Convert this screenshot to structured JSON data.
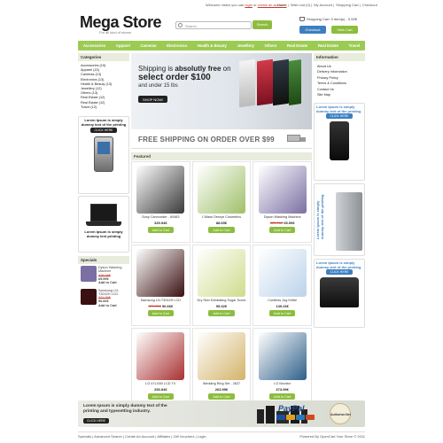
{
  "topbar": {
    "welcome": "Welcome visitor you can",
    "login": "login",
    "or": "or",
    "create": "create an account.",
    "links": [
      "Home",
      "Wish List (0)",
      "My Account",
      "Shopping Cart",
      "Checkout"
    ]
  },
  "header": {
    "logo": "Mega Store",
    "tagline": "For all kind of stores",
    "search_placeholder": "Search",
    "search_button": "Search",
    "cart_text": "Shopping Cart: 0 item(s) - 0.00€",
    "checkout_button": "Checkout",
    "viewcart_button": "View Cart"
  },
  "nav": [
    "Accessories",
    "Apparel",
    "Cameras",
    "Electronics",
    "Health & Beauty",
    "Jewellery",
    "Others",
    "Real Estate",
    "Real Estate",
    "Travel"
  ],
  "categories": {
    "title": "Categories",
    "items": [
      "Accessories (15)",
      "Apparel (15)",
      "Cameras (13)",
      "Electronics (13)",
      "Health & Beauty (13)",
      "Jewellery (12)",
      "Others (13)",
      "Real Estate (12)",
      "Real Estate (12)",
      "Travel (12)"
    ]
  },
  "promo_left_1": {
    "title": "Lorem Ipsum is simply dummy text of the printing",
    "button": "CLICK HERE"
  },
  "promo_left_2": {
    "title": "Lorem Ipsum is simply dummy text printing"
  },
  "specials": {
    "title": "Specials",
    "items": [
      {
        "name": "Dyson Washing Machine",
        "old": "425.26€",
        "price": "65.99€",
        "button": "Add to Cart"
      },
      {
        "name": "Samsung LN-T3242H LCD",
        "old": "371.25€",
        "price": "56.66€",
        "button": "Add to Cart"
      }
    ]
  },
  "banner": {
    "line1_a": "Shipping is",
    "line1_b": "absolutly free",
    "line1_c": "on",
    "line2": "select order $100",
    "line3": "and under 15 lbs",
    "button": "SHOP NOW!"
  },
  "shipping_bar": "FREE SHIPPING ON ORDER OVER $99",
  "featured": {
    "title": "Featured",
    "products": [
      {
        "name": "Sony Camcorder - 60483",
        "old": "",
        "price": "329.94€",
        "button": "Add to Cart",
        "color": "#3a3a3a"
      },
      {
        "name": "L'Mase Desrye Cosmetics",
        "old": "",
        "price": "88.65€",
        "button": "Add to Cart",
        "color": "#9fc06a"
      },
      {
        "name": "Dyson Washing Machine",
        "old": "425.26€",
        "price": "65.99€",
        "button": "Add to Cart",
        "color": "#7b6fa3"
      },
      {
        "name": "Samsung LN-T3242H LCD",
        "old": "371.25€",
        "price": "56.66€",
        "button": "Add to Cart",
        "color": "#3a1010"
      },
      {
        "name": "Dry Skin Exfoliating Sugar Scrub",
        "old": "",
        "price": "95.32€",
        "button": "Add to Cart",
        "color": "#cfdc8c"
      },
      {
        "name": "Cordless Jug Kettle",
        "old": "",
        "price": "139.23€",
        "button": "Add to Cart",
        "color": "#bcd3ea"
      },
      {
        "name": "LG 47LG50 LCD TV",
        "old": "",
        "price": "253.94€",
        "button": "Add to Cart",
        "color": "#a83030"
      },
      {
        "name": "Wedding Ring Set - 2627",
        "old": "",
        "price": "263.99€",
        "button": "Add to Cart",
        "color": "#d3b36a"
      },
      {
        "name": "LG Monitor",
        "old": "",
        "price": "373.99€",
        "button": "Add to Cart",
        "color": "#2f5f8a"
      }
    ]
  },
  "information": {
    "title": "Information",
    "items": [
      "About Us",
      "Delivery Information",
      "Privacy Policy",
      "Terms & Conditions",
      "Contact Us",
      "Site Map"
    ]
  },
  "promo_right": [
    {
      "title": "Lorem Ipsum is simply dummy text of the printing",
      "button": "CLICK HERE"
    },
    {
      "title": "Lorem Ipsum is simply dummy text of the printing",
      "button": ""
    },
    {
      "title": "Lorem Ipsum is simply dummy text of the printing",
      "button": "CLICK HERE"
    }
  ],
  "bottom_banner": {
    "text": "Lorem Ipsum is simply dummy text of the printing and typesetting industry.",
    "button": "CLICK HERE"
  },
  "paypal": "PayPal",
  "seal": "Authorize.Net",
  "footer": {
    "links": [
      "Specials",
      "Advanced Search",
      "Create An Account",
      "Affiliates",
      "Gift Vouchers",
      "Login"
    ],
    "powered": "Powered By OpenCart Your Store © 2011"
  },
  "colors": {
    "accent_green": "#8cbd3e",
    "accent_blue": "#3c7fc0",
    "nav_green": "#9ccb53"
  }
}
